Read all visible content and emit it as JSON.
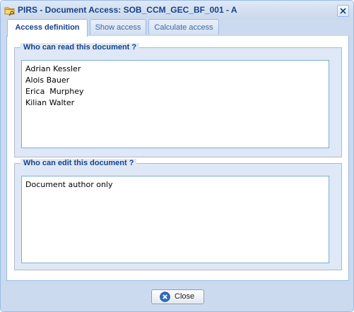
{
  "window": {
    "title": "PIRS - Document Access: SOB_CCM_GEC_BF_001 - A",
    "icons": {
      "title_icon": "folder-key-icon",
      "close_tool": "close-icon"
    }
  },
  "tabs": [
    {
      "label": "Access definition",
      "active": true
    },
    {
      "label": "Show access",
      "active": false
    },
    {
      "label": "Calculate access",
      "active": false
    }
  ],
  "read_section": {
    "legend": "Who can read this document ?",
    "lines": [
      "Adrian Kessler",
      "Alois Bauer",
      "Erica  Murphey",
      "Kilian Walter"
    ]
  },
  "edit_section": {
    "legend": "Who can edit this document ?",
    "lines": [
      "Document author only"
    ]
  },
  "footer": {
    "close_label": "Close",
    "close_icon": "cancel-circle-icon"
  },
  "colors": {
    "window_bg": "#cbdaee",
    "accent_text": "#15428b",
    "border": "#99bbe8"
  }
}
